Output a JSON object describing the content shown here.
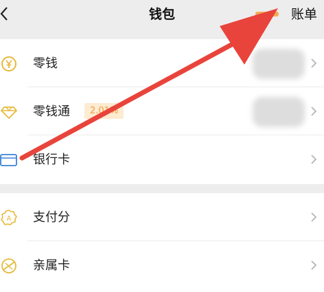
{
  "header": {
    "title": "钱包",
    "right_action": "账单",
    "back_icon": "chevron-left-icon"
  },
  "wallet_items": [
    {
      "label": "零钱",
      "icon": "yen-coin-icon",
      "value_hidden": true
    },
    {
      "label": "零钱通",
      "icon": "diamond-icon",
      "badge": "2.01%",
      "value_hidden": true
    },
    {
      "label": "银行卡",
      "icon": "bank-card-icon"
    }
  ],
  "service_items": [
    {
      "label": "支付分",
      "icon": "pay-score-icon"
    },
    {
      "label": "亲属卡",
      "icon": "family-card-icon"
    }
  ],
  "annotation": {
    "type": "arrow",
    "color": "#e8443c",
    "points_to": "账单"
  }
}
